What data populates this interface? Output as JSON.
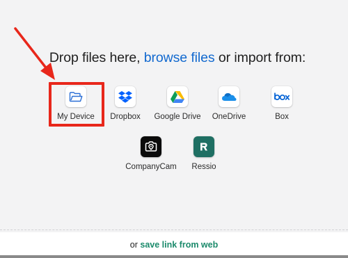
{
  "headline": {
    "prefix": "Drop files here,",
    "link": "browse files",
    "suffix": "or import from:"
  },
  "providers": [
    {
      "id": "my-device",
      "label": "My Device",
      "icon": "folder-icon"
    },
    {
      "id": "dropbox",
      "label": "Dropbox",
      "icon": "dropbox-icon"
    },
    {
      "id": "google-drive",
      "label": "Google Drive",
      "icon": "google-drive-icon"
    },
    {
      "id": "onedrive",
      "label": "OneDrive",
      "icon": "onedrive-icon"
    },
    {
      "id": "box",
      "label": "Box",
      "icon": "box-icon"
    },
    {
      "id": "companycam",
      "label": "CompanyCam",
      "icon": "companycam-icon"
    },
    {
      "id": "ressio",
      "label": "Ressio",
      "icon": "ressio-icon"
    }
  ],
  "footer": {
    "prefix": "or",
    "link": "save link from web"
  },
  "colors": {
    "link_blue": "#1269cf",
    "link_green": "#1b8a6b",
    "highlight_red": "#e8271b"
  }
}
